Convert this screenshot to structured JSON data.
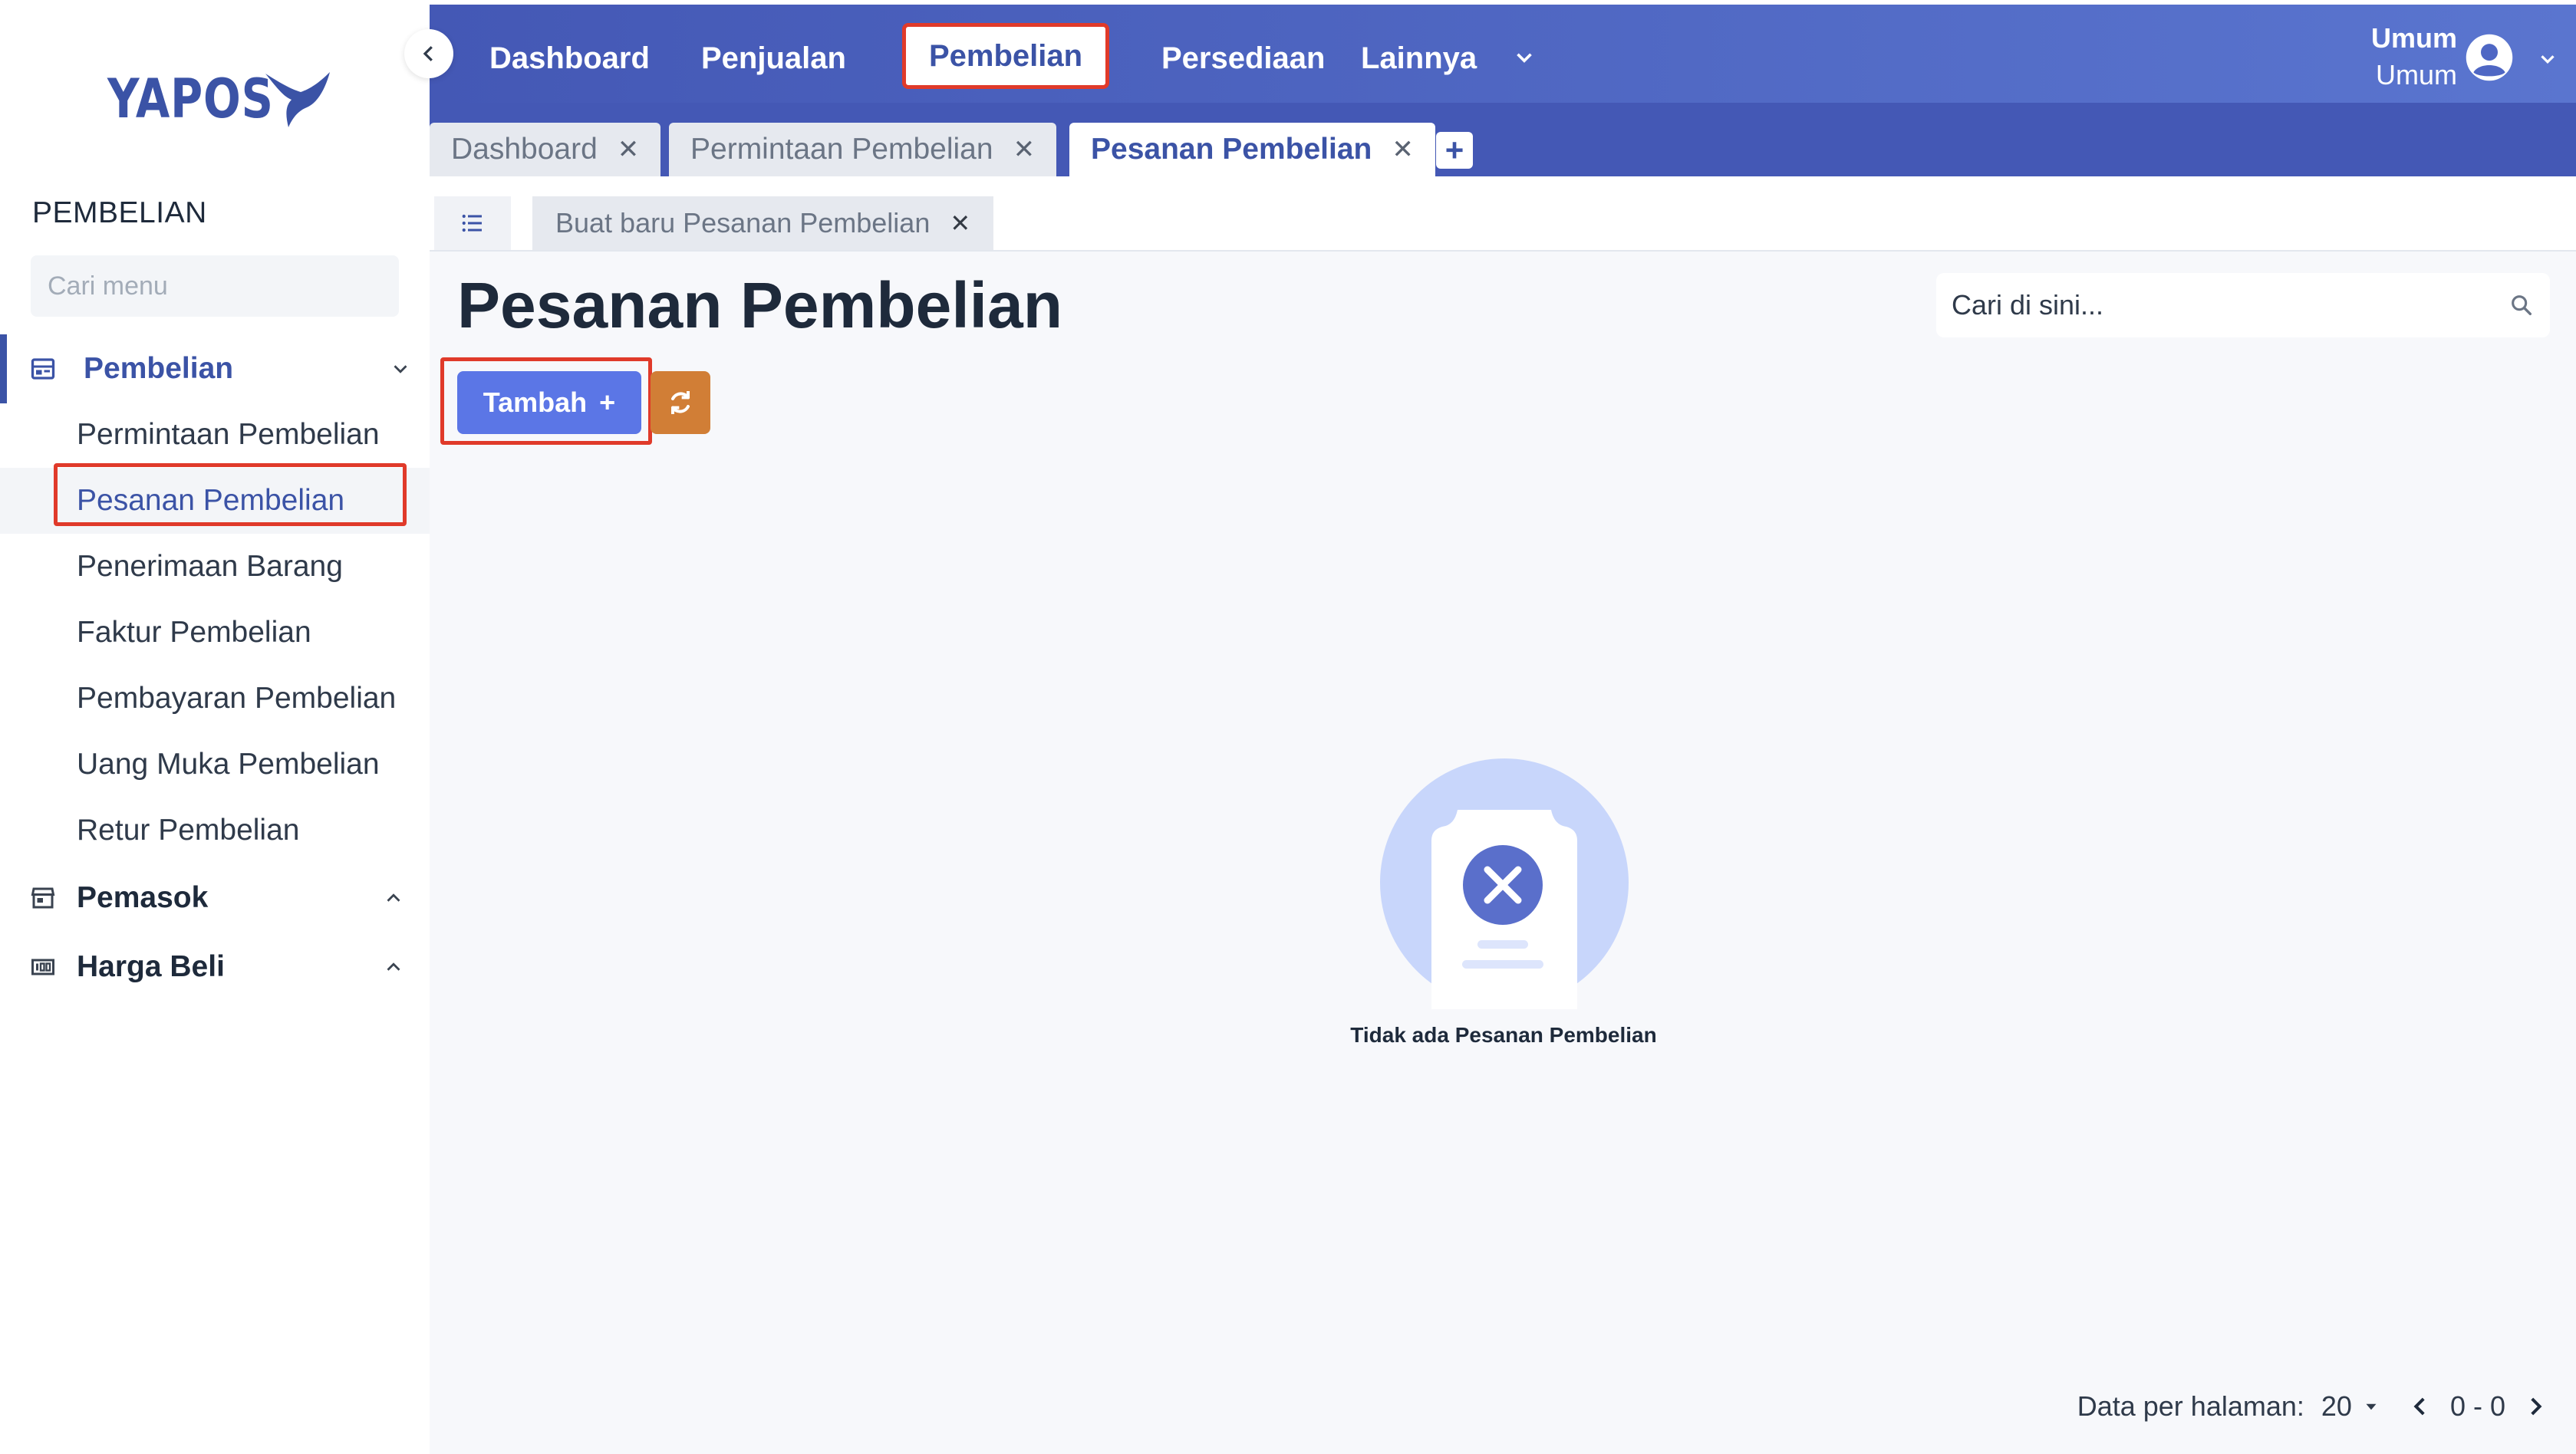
{
  "app": {
    "logo_text": "YAPOS"
  },
  "sidebar": {
    "section_title": "PEMBELIAN",
    "search_placeholder": "Cari menu",
    "groups": [
      {
        "label": "Pembelian",
        "icon": "purchase-icon",
        "expanded": true,
        "items": [
          {
            "label": "Permintaan Pembelian"
          },
          {
            "label": "Pesanan Pembelian",
            "active": true
          },
          {
            "label": "Penerimaan Barang"
          },
          {
            "label": "Faktur Pembelian"
          },
          {
            "label": "Pembayaran Pembelian"
          },
          {
            "label": "Uang Muka Pembelian"
          },
          {
            "label": "Retur Pembelian"
          }
        ]
      },
      {
        "label": "Pemasok",
        "icon": "store-icon",
        "expanded": false
      },
      {
        "label": "Harga Beli",
        "icon": "price-icon",
        "expanded": false
      }
    ]
  },
  "topnav": {
    "items": [
      {
        "label": "Dashboard"
      },
      {
        "label": "Penjualan"
      },
      {
        "label": "Pembelian",
        "active": true
      },
      {
        "label": "Persediaan"
      },
      {
        "label": "Lainnya"
      }
    ],
    "user": {
      "name": "Umum",
      "role": "Umum"
    }
  },
  "tabs": [
    {
      "label": "Dashboard"
    },
    {
      "label": "Permintaan Pembelian"
    },
    {
      "label": "Pesanan Pembelian",
      "active": true
    }
  ],
  "tab_add_label": "+",
  "subtab": {
    "label": "Buat baru Pesanan Pembelian"
  },
  "main": {
    "title": "Pesanan Pembelian",
    "search_placeholder": "Cari di sini...",
    "add_button": "Tambah",
    "add_symbol": "+",
    "empty_text": "Tidak ada Pesanan Pembelian"
  },
  "pagination": {
    "label": "Data per halaman:",
    "per_page": "20",
    "range": "0 - 0"
  },
  "colors": {
    "primary": "#3b53a6",
    "topbar": "#4458b5",
    "add_button": "#5b76e6",
    "refresh_button": "#d17e36",
    "highlight": "#e03a2a"
  }
}
